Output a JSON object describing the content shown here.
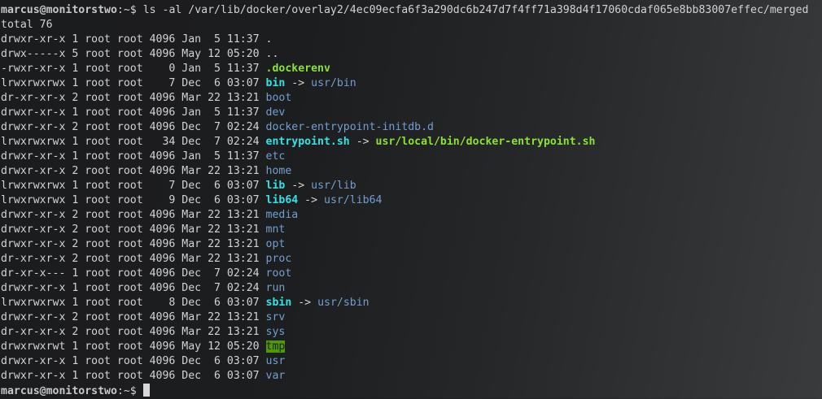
{
  "prompt": {
    "user_host": "marcus@monitorstwo",
    "path_suffix": ":~$ ",
    "command": "ls -al /var/lib/docker/overlay2/4ec09ecfa6f3a290dc6b247d7f4ff71a398d4f17060cdaf065e8bb83007effec/merged"
  },
  "total_line": "total 76",
  "entries": [
    {
      "meta": "drwxr-xr-x 1 root root 4096 Jan  5 11:37 ",
      "name": ".",
      "kind": "plain",
      "arrow": "",
      "target": ""
    },
    {
      "meta": "drwx-----x 5 root root 4096 May 12 05:20 ",
      "name": "..",
      "kind": "plain",
      "arrow": "",
      "target": ""
    },
    {
      "meta": "-rwxr-xr-x 1 root root    0 Jan  5 11:37 ",
      "name": ".dockerenv",
      "kind": "exec",
      "arrow": "",
      "target": ""
    },
    {
      "meta": "lrwxrwxrwx 1 root root    7 Dec  6 03:07 ",
      "name": "bin",
      "kind": "link",
      "arrow": " -> ",
      "target": "usr/bin",
      "target_kind": "dir"
    },
    {
      "meta": "dr-xr-xr-x 2 root root 4096 Mar 22 13:21 ",
      "name": "boot",
      "kind": "dir",
      "arrow": "",
      "target": ""
    },
    {
      "meta": "drwxr-xr-x 1 root root 4096 Jan  5 11:37 ",
      "name": "dev",
      "kind": "dir",
      "arrow": "",
      "target": ""
    },
    {
      "meta": "drwxr-xr-x 2 root root 4096 Dec  7 02:24 ",
      "name": "docker-entrypoint-initdb.d",
      "kind": "dir",
      "arrow": "",
      "target": ""
    },
    {
      "meta": "lrwxrwxrwx 1 root root   34 Dec  7 02:24 ",
      "name": "entrypoint.sh",
      "kind": "link",
      "arrow": " -> ",
      "target": "usr/local/bin/docker-entrypoint.sh",
      "target_kind": "exec"
    },
    {
      "meta": "drwxr-xr-x 1 root root 4096 Jan  5 11:37 ",
      "name": "etc",
      "kind": "dir",
      "arrow": "",
      "target": ""
    },
    {
      "meta": "drwxr-xr-x 2 root root 4096 Mar 22 13:21 ",
      "name": "home",
      "kind": "dir",
      "arrow": "",
      "target": ""
    },
    {
      "meta": "lrwxrwxrwx 1 root root    7 Dec  6 03:07 ",
      "name": "lib",
      "kind": "link",
      "arrow": " -> ",
      "target": "usr/lib",
      "target_kind": "dir"
    },
    {
      "meta": "lrwxrwxrwx 1 root root    9 Dec  6 03:07 ",
      "name": "lib64",
      "kind": "link",
      "arrow": " -> ",
      "target": "usr/lib64",
      "target_kind": "dir"
    },
    {
      "meta": "drwxr-xr-x 2 root root 4096 Mar 22 13:21 ",
      "name": "media",
      "kind": "dir",
      "arrow": "",
      "target": ""
    },
    {
      "meta": "drwxr-xr-x 2 root root 4096 Mar 22 13:21 ",
      "name": "mnt",
      "kind": "dir",
      "arrow": "",
      "target": ""
    },
    {
      "meta": "drwxr-xr-x 2 root root 4096 Mar 22 13:21 ",
      "name": "opt",
      "kind": "dir",
      "arrow": "",
      "target": ""
    },
    {
      "meta": "dr-xr-xr-x 2 root root 4096 Mar 22 13:21 ",
      "name": "proc",
      "kind": "dir",
      "arrow": "",
      "target": ""
    },
    {
      "meta": "dr-xr-x--- 1 root root 4096 Dec  7 02:24 ",
      "name": "root",
      "kind": "dir",
      "arrow": "",
      "target": ""
    },
    {
      "meta": "drwxr-xr-x 1 root root 4096 Dec  7 02:24 ",
      "name": "run",
      "kind": "dir",
      "arrow": "",
      "target": ""
    },
    {
      "meta": "lrwxrwxrwx 1 root root    8 Dec  6 03:07 ",
      "name": "sbin",
      "kind": "link",
      "arrow": " -> ",
      "target": "usr/sbin",
      "target_kind": "dir"
    },
    {
      "meta": "drwxr-xr-x 2 root root 4096 Mar 22 13:21 ",
      "name": "srv",
      "kind": "dir",
      "arrow": "",
      "target": ""
    },
    {
      "meta": "dr-xr-xr-x 2 root root 4096 Mar 22 13:21 ",
      "name": "sys",
      "kind": "dir",
      "arrow": "",
      "target": ""
    },
    {
      "meta": "drwxrwxrwt 1 root root 4096 May 12 05:20 ",
      "name": "tmp",
      "kind": "sticky",
      "arrow": "",
      "target": ""
    },
    {
      "meta": "drwxr-xr-x 1 root root 4096 Dec  6 03:07 ",
      "name": "usr",
      "kind": "dir",
      "arrow": "",
      "target": ""
    },
    {
      "meta": "drwxr-xr-x 1 root root 4096 Dec  6 03:07 ",
      "name": "var",
      "kind": "dir",
      "arrow": "",
      "target": ""
    }
  ],
  "final_prompt": {
    "user_host": "marcus@monitorstwo",
    "path_suffix": ":~$ "
  },
  "colors": {
    "background": "#1c1d1f",
    "text": "#d3d3d3",
    "directory": "#729fcf",
    "symlink": "#34e2e2",
    "executable": "#8ae234",
    "sticky_dir_bg": "#4e9a06"
  }
}
